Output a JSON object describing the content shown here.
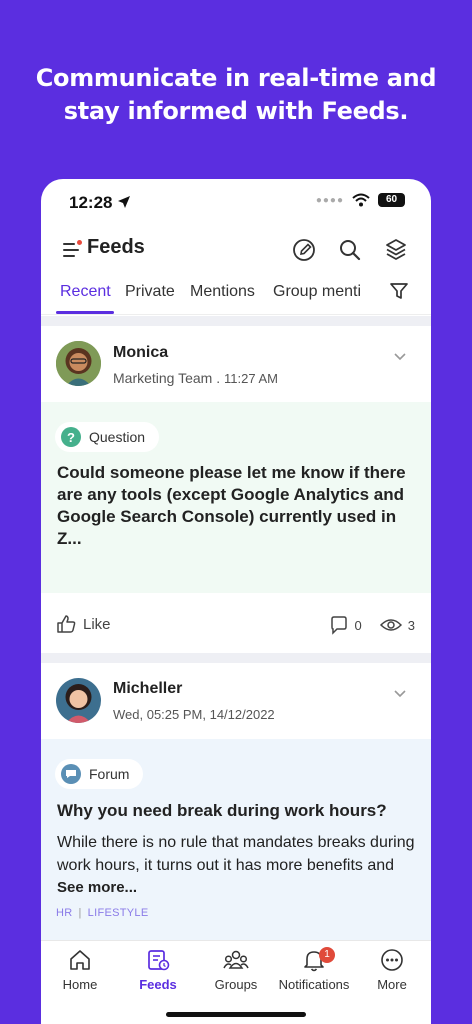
{
  "headline": {
    "line1": "Communicate in real-time and",
    "line2": "stay informed with Feeds."
  },
  "status": {
    "time": "12:28",
    "battery": "60"
  },
  "appbar": {
    "title": "Feeds"
  },
  "tabs": [
    {
      "label": "Recent",
      "active": true
    },
    {
      "label": "Private"
    },
    {
      "label": "Mentions"
    },
    {
      "label": "Group menti"
    }
  ],
  "posts": [
    {
      "author": "Monica",
      "meta": "Marketing Team .",
      "time": "11:27 AM",
      "badge": "Question",
      "title": "Could someone please let me know if there are any tools (except Google Analytics and Google Search Console) currently used in Z...",
      "actions": {
        "like": "Like",
        "comments": "0",
        "views": "3"
      }
    },
    {
      "author": "Micheller",
      "meta": "Wed, 05:25 PM, 14/12/2022",
      "badge": "Forum",
      "title": "Why you need break during work hours?",
      "desc": "While there is no rule that mandates breaks during work hours, it turns out it has more benefits and",
      "see_more": "See more...",
      "tags": [
        "HR",
        "LIFESTYLE"
      ]
    }
  ],
  "nav": [
    {
      "label": "Home",
      "icon": "home-icon"
    },
    {
      "label": "Feeds",
      "icon": "feeds-icon",
      "active": true
    },
    {
      "label": "Groups",
      "icon": "groups-icon"
    },
    {
      "label": "Notifications",
      "icon": "bell-icon",
      "badge": "1"
    },
    {
      "label": "More",
      "icon": "more-icon"
    }
  ],
  "colors": {
    "accent": "#5b2ee0",
    "question_bg": "#f1faf4",
    "forum_bg": "#eef5fc",
    "notification_badge": "#e04a3a"
  }
}
